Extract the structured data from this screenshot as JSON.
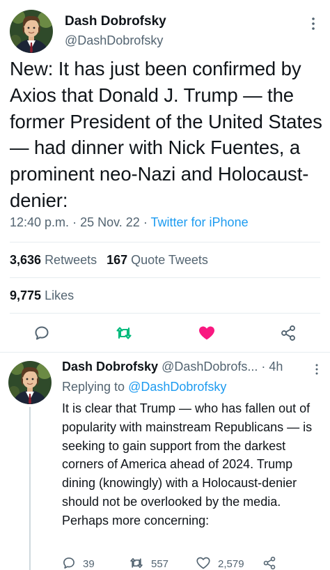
{
  "main_tweet": {
    "author_name": "Dash Dobrofsky",
    "author_handle": "@DashDobrofsky",
    "text": "New: It has just been confirmed by Axios that Donald J. Trump — the former President of the United States — had dinner with Nick Fuentes, a prominent neo-Nazi and Holocaust-denier:",
    "time": "12:40 p.m.",
    "date": "25 Nov. 22",
    "separator": "·",
    "source": "Twitter for iPhone",
    "retweets_count": "3,636",
    "retweets_label": "Retweets",
    "quote_count": "167",
    "quote_label": "Quote Tweets",
    "likes_count": "9,775",
    "likes_label": "Likes",
    "icons": [
      "reply-icon",
      "retweet-icon",
      "like-icon",
      "share-icon",
      "more-icon"
    ],
    "colors": {
      "retweet": "#00ba7c",
      "like": "#f91880",
      "link": "#1d9bf0",
      "muted": "#536471"
    }
  },
  "reply_tweet": {
    "author_name": "Dash Dobrofsky",
    "author_handle": "@DashDobrofs...",
    "separator": "·",
    "time_ago": "4h",
    "replying_prefix": "Replying to",
    "replying_handle": "@DashDobrofsky",
    "text": "It is clear that Trump — who has fallen out of popularity with mainstream Republicans — is seeking to gain support from the darkest corners of America ahead of 2024. Trump dining (knowingly) with a Holocaust-denier should not be overlooked by the media. Perhaps more concerning:",
    "reply_count": "39",
    "retweet_count": "557",
    "like_count": "2,579"
  }
}
